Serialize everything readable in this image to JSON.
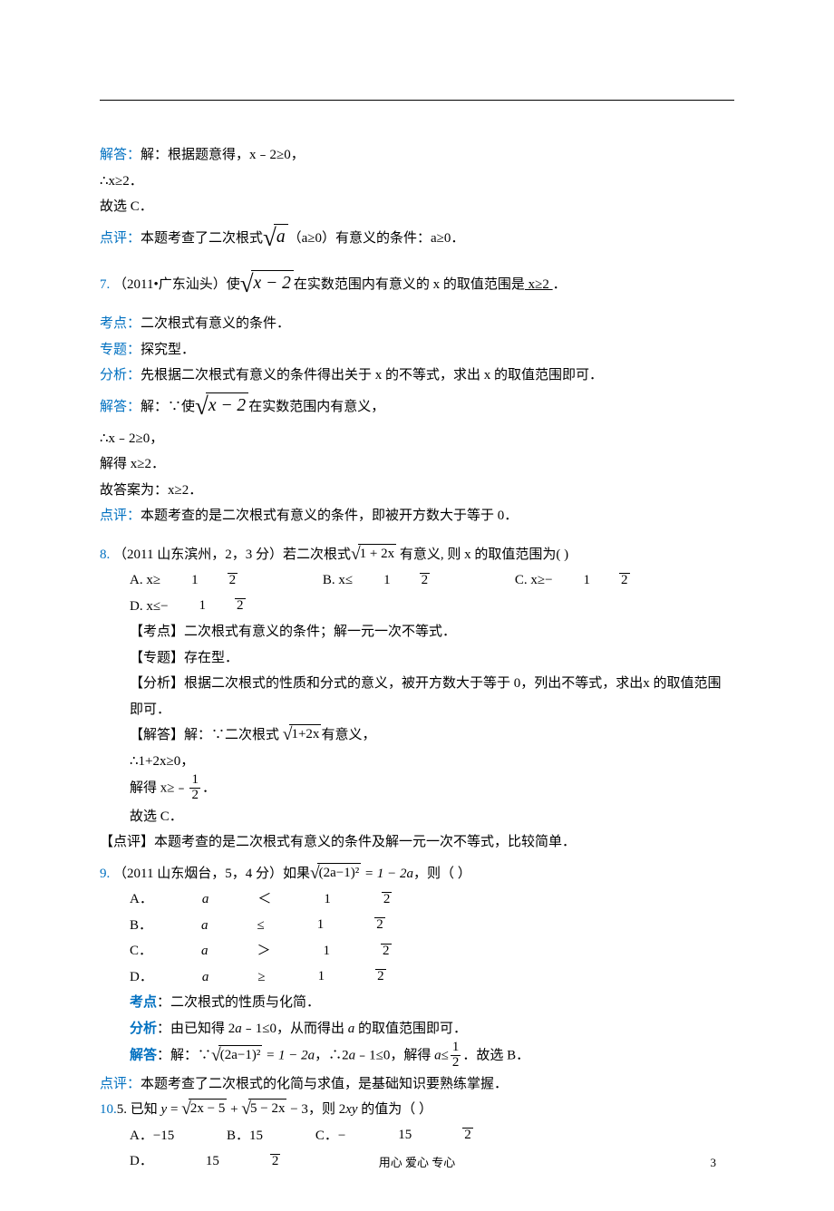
{
  "p6": {
    "a1": "解答：",
    "a1t": "解：根据题意得，x﹣2≥0，",
    "a2": "∴x≥2．",
    "a3": "故选 C．",
    "b1": "点评：",
    "b1t_a": "本题考查了二次根式",
    "b1t_rad": "a",
    "b1t_b": "（a≥0）有意义的条件：a≥0．"
  },
  "p7": {
    "num": "7.",
    "src": " （2011•广东汕头）使",
    "rad": "x − 2",
    "after": "在实数范围内有意义的 x 的取值范围是",
    "ans": "  x≥2  ",
    "period": "．",
    "kd_l": "考点：",
    "kd_t": "二次根式有意义的条件．",
    "zt_l": "专题：",
    "zt_t": "探究型．",
    "fx_l": "分析：",
    "fx_t": "先根据二次根式有意义的条件得出关于 x 的不等式，求出 x 的取值范围即可．",
    "jd_l": "解答：",
    "jd_t1": "解：∵使",
    "jd_rad": "x − 2",
    "jd_t2": "在实数范围内有意义，",
    "s1": "∴x﹣2≥0，",
    "s2": "解得 x≥2．",
    "s3": "故答案为：x≥2．",
    "dp_l": "点评：",
    "dp_t": "本题考查的是二次根式有意义的条件，即被开方数大于等于 0．"
  },
  "p8": {
    "num": "8.",
    "src": " （2011 山东滨州，2，3 分）若二次根式",
    "rad": "1 + 2x",
    "after": " 有意义, 则 x 的取值范围为(    )",
    "oA": "A. x≥",
    "oB": "B.  x≤",
    "oC": "C. x≥−",
    "oD": "D. x≤−",
    "f_num": "1",
    "f_den": "2",
    "l1": "【考点】二次根式有意义的条件；解一元一次不等式．",
    "l2": "【专题】存在型．",
    "l3": "【分析】根据二次根式的性质和分式的意义，被开方数大于等于 0，列出不等式，求出x 的取值范围即可．",
    "l4a": "【解答】解：∵二次根式 ",
    "l4rad": "1+2x",
    "l4b": "有意义，",
    "l5": "∴1+2x≥0，",
    "l6a": "解得 x≥﹣",
    "l6b": "．",
    "l7": "故选 C．",
    "dp": "【点评】本题考查的是二次根式有意义的条件及解一元一次不等式，比较简单．"
  },
  "p9": {
    "num": "9.",
    "src": " （2011 山东烟台，5，4 分）如果",
    "rad": "(2a−1)²",
    "eq": " = 1 − 2a",
    "after": "，则（     ）",
    "oA": "A．",
    "oAa1": "a",
    "oAa2": "＜",
    "oB": "B．",
    "oBa1": "a",
    "oBa2": "≤",
    "oC": "C．",
    "oCa1": "a",
    "oCa2": "＞",
    "oD": "D．",
    "oDa1": "a",
    "oDa2": "≥",
    "f_num": "1",
    "f_den": "2",
    "kd_l": "考点",
    "kd_t": "：二次根式的性质与化简．",
    "fx_l": "分析",
    "fx_t": "：由已知得 2",
    "fx_a": "a",
    "fx_t2": "﹣1≤0，从而得出 ",
    "fx_a2": "a",
    "fx_t3": " 的取值范围即可．",
    "jd_l": "解答",
    "jd_t1": "：解：∵",
    "jd_rad": "(2a−1)²",
    "jd_eq": " = 1 − 2a",
    "jd_t2": "，∴2",
    "jd_a": "a",
    "jd_t3": "﹣1≤0，解得 ",
    "jd_a2": "a",
    "jd_t4": "≤",
    "jd_t5": "．故选 B．",
    "dp_l": "点评：",
    "dp_t": "本题考查了二次根式的化简与求值，是基础知识要熟练掌握．"
  },
  "p10": {
    "num": "10.",
    "q": "5. 已知 ",
    "y": "y",
    "eq_a": " = ",
    "rad1": "2x − 5",
    "plus": " + ",
    "rad2": "5 − 2x",
    "minus3": " − 3",
    "after": "，则 2",
    "xy": "xy",
    "after2": " 的值为（   ）",
    "oA": "A．−15",
    "oB": "B．15",
    "oC": "C．−",
    "oD": "D．",
    "f_num": "15",
    "f_den": "2"
  },
  "footer": {
    "txt": "用心   爱心  专心",
    "pg": "3"
  }
}
